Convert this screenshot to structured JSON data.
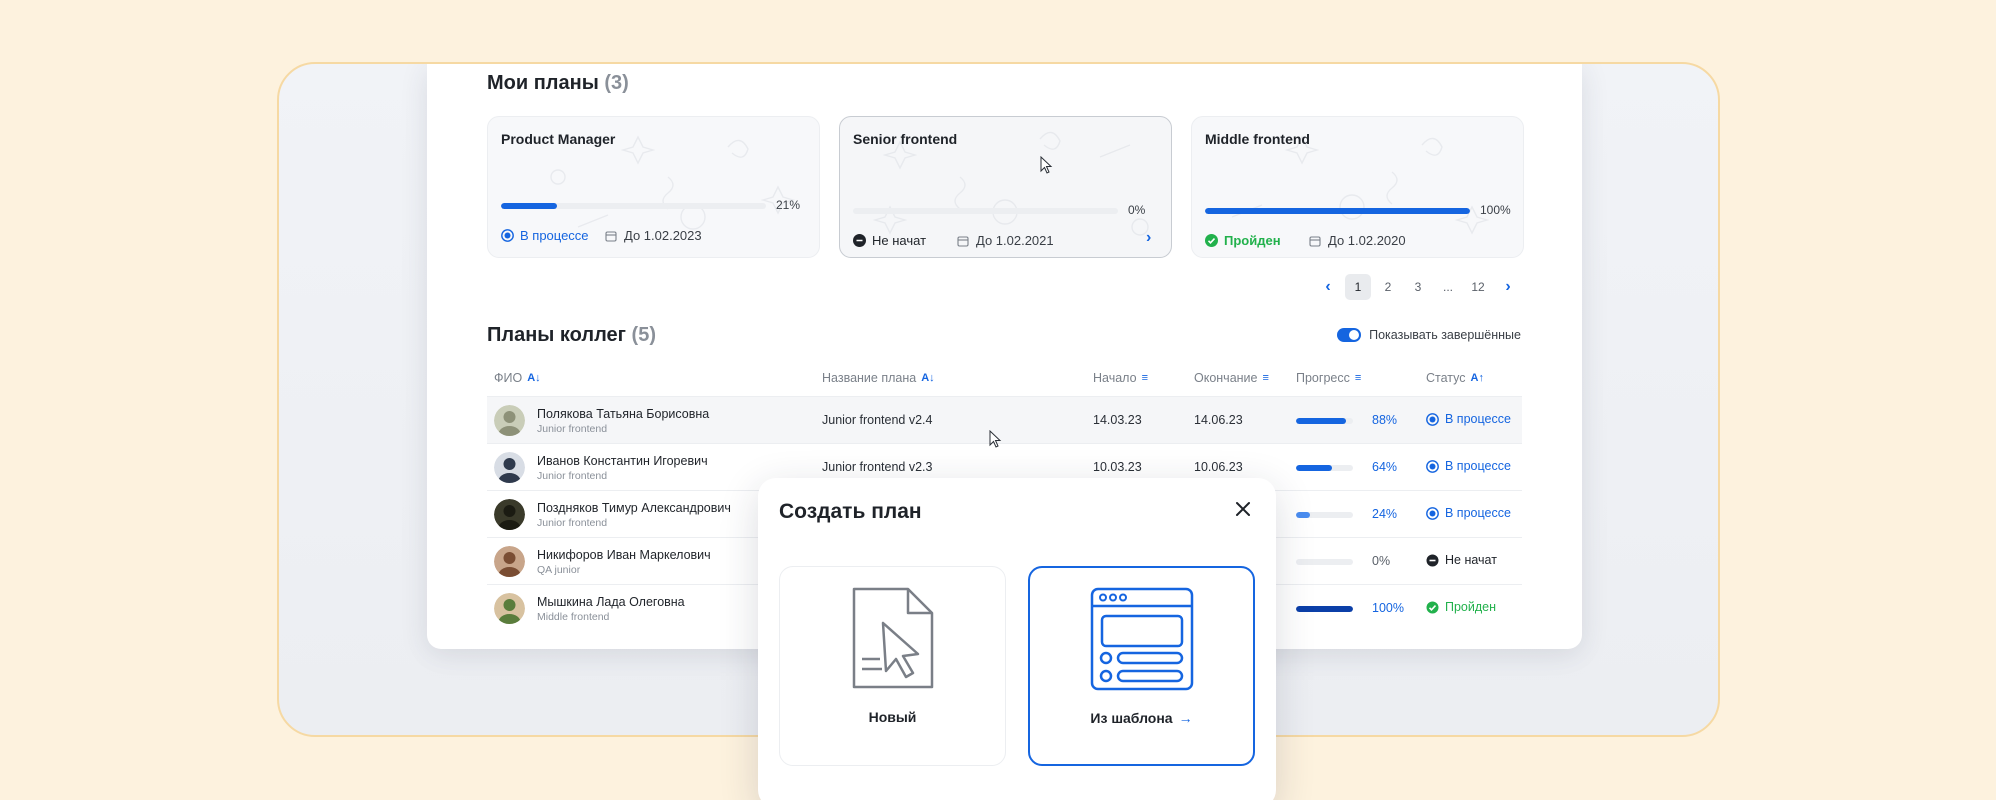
{
  "my_plans": {
    "title": "Мои планы",
    "count": "(3)",
    "cards": [
      {
        "title": "Product Manager",
        "progress": 21,
        "progress_label": "21%",
        "status": "В процессе",
        "status_kind": "in_progress",
        "date": "До 1.02.2023"
      },
      {
        "title": "Senior frontend",
        "progress": 0,
        "progress_label": "0%",
        "status": "Не начат",
        "status_kind": "not_started",
        "date": "До 1.02.2021"
      },
      {
        "title": "Middle frontend",
        "progress": 100,
        "progress_label": "100%",
        "status": "Пройден",
        "status_kind": "done",
        "date": "До 1.02.2020"
      }
    ]
  },
  "pagination": {
    "pages": [
      "1",
      "2",
      "3",
      "...",
      "12"
    ],
    "current": "1"
  },
  "colleagues": {
    "title": "Планы коллег",
    "count": "(5)",
    "toggle_label": "Показывать завершённые",
    "toggle_on": true,
    "columns": [
      "ФИО",
      "Название плана",
      "Начало",
      "Окончание",
      "Прогресс",
      "Статус"
    ],
    "rows": [
      {
        "name": "Полякова Татьяна Борисовна",
        "role": "Junior frontend",
        "plan": "Junior frontend v2.4",
        "start": "14.03.23",
        "end": "14.06.23",
        "progress": 88,
        "progress_label": "88%",
        "status": "В процессе",
        "status_kind": "in_progress"
      },
      {
        "name": "Иванов Константин Игоревич",
        "role": "Junior frontend",
        "plan": "Junior frontend v2.3",
        "start": "10.03.23",
        "end": "10.06.23",
        "progress": 64,
        "progress_label": "64%",
        "status": "В процессе",
        "status_kind": "in_progress"
      },
      {
        "name": "Поздняков Тимур Александрович",
        "role": "Junior frontend",
        "plan": "",
        "start": "",
        "end": "",
        "progress": 24,
        "progress_label": "24%",
        "status": "В процессе",
        "status_kind": "in_progress"
      },
      {
        "name": "Никифоров Иван Маркелович",
        "role": "QA junior",
        "plan": "",
        "start": "",
        "end": "",
        "progress": 0,
        "progress_label": "0%",
        "status": "Не начат",
        "status_kind": "not_started"
      },
      {
        "name": "Мышкина Лада Олеговна",
        "role": "Middle frontend",
        "plan": "",
        "start": "",
        "end": "",
        "progress": 100,
        "progress_label": "100%",
        "status": "Пройден",
        "status_kind": "done"
      }
    ]
  },
  "modal": {
    "title": "Создать план",
    "options": [
      {
        "label": "Новый",
        "icon": "new-document-cursor-icon",
        "selected": false
      },
      {
        "label": "Из шаблона",
        "icon": "template-layout-icon",
        "selected": true
      }
    ]
  },
  "colors": {
    "accent": "#1565e0",
    "success": "#22b14c",
    "neutral": "#2a2f36"
  }
}
